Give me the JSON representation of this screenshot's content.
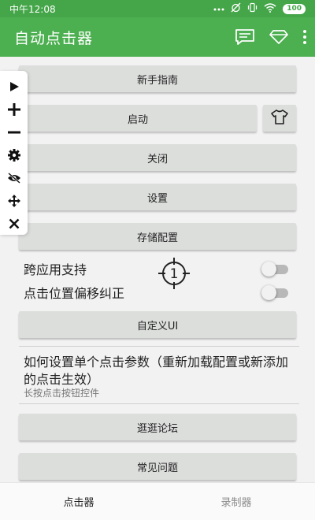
{
  "status_bar": {
    "time": "中午12:08",
    "battery": "100"
  },
  "app_bar": {
    "title": "自动点击器"
  },
  "buttons": {
    "guide": "新手指南",
    "start": "启动",
    "close": "关闭",
    "settings": "设置",
    "save_config": "存储配置",
    "custom_ui": "自定义UI",
    "forum": "逛逛论坛",
    "faq": "常见问题"
  },
  "toggles": {
    "cross_app": {
      "label": "跨应用支持",
      "on": false
    },
    "offset_fix": {
      "label": "点击位置偏移纠正",
      "on": false
    }
  },
  "crosshair": {
    "number": "1"
  },
  "info": {
    "title": "如何设置单个点击参数（重新加载配置或新添加的点击生效）",
    "subtitle": "长按点击按钮控件"
  },
  "tabs": [
    {
      "label": "点击器",
      "active": true
    },
    {
      "label": "录制器",
      "active": false
    }
  ],
  "floating_toolbar": [
    "play-icon",
    "plus-icon",
    "minus-icon",
    "gear-icon",
    "eye-off-icon",
    "move-icon",
    "close-icon"
  ],
  "colors": {
    "primary": "#4caf50",
    "status_bar": "#45a649",
    "button_bg": "#dcdedc"
  }
}
